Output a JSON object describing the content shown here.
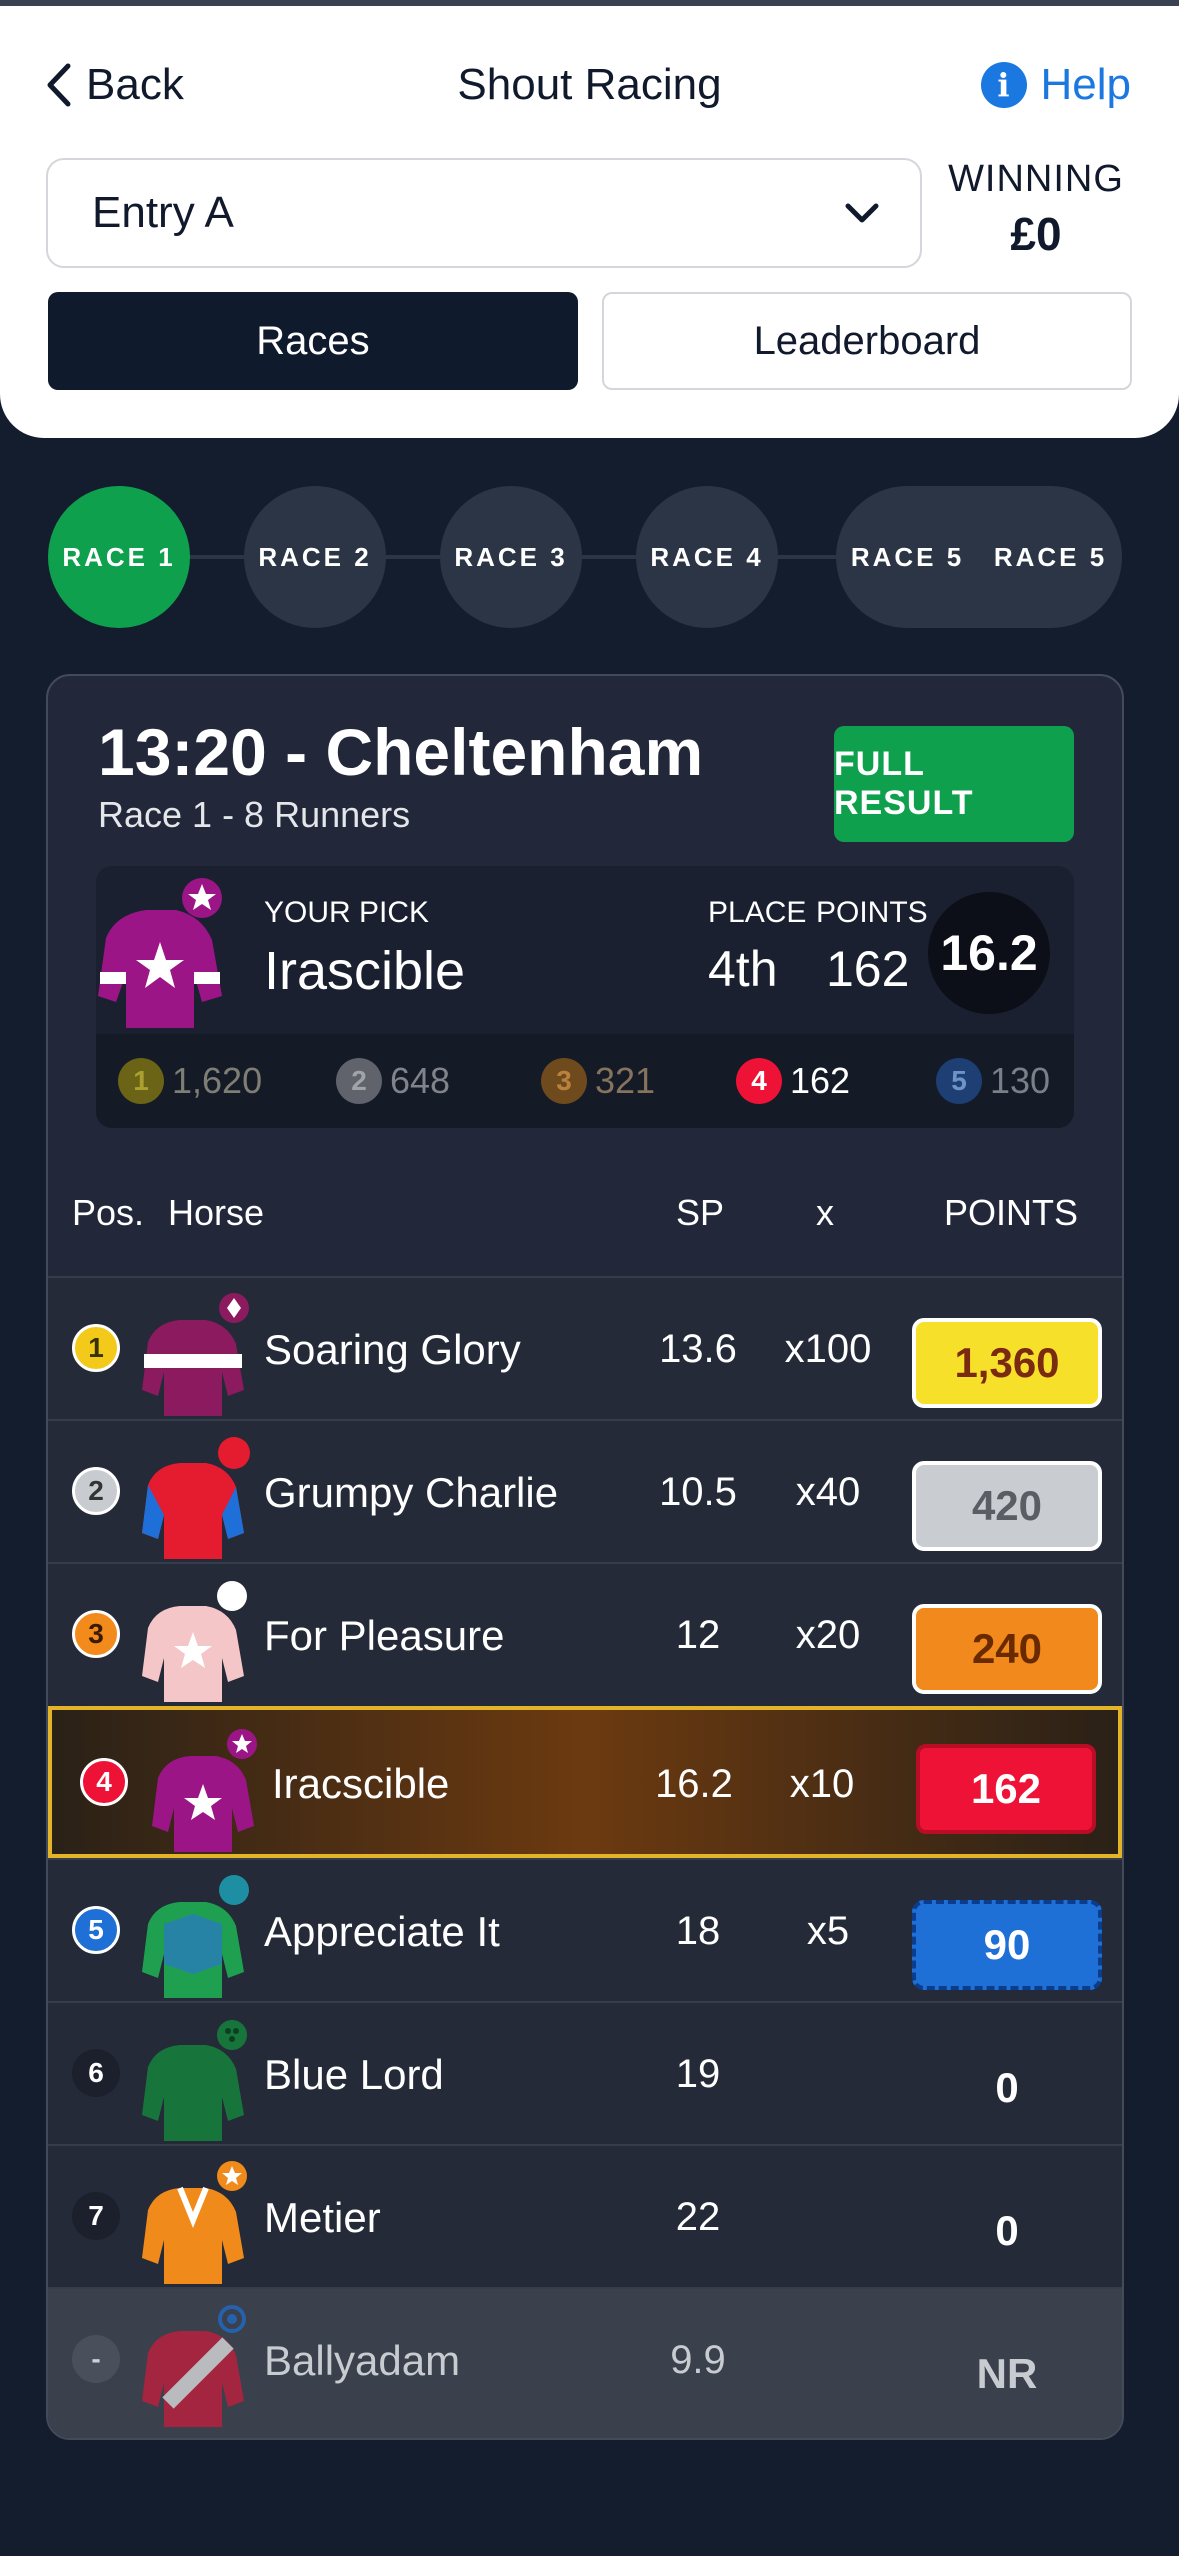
{
  "header": {
    "back_label": "Back",
    "title": "Shout Racing",
    "help_label": "Help",
    "entry_select": "Entry A",
    "winning_label": "WINNING",
    "winning_value": "£0",
    "tabs": [
      {
        "label": "Races"
      },
      {
        "label": "Leaderboard"
      }
    ]
  },
  "races_nav": [
    "RACE 1",
    "RACE 2",
    "RACE 3",
    "RACE 4",
    "RACE 5",
    "RACE 5"
  ],
  "race": {
    "title": "13:20 - Cheltenham",
    "subtitle": "Race 1 - 8 Runners",
    "full_result_label": "FULL RESULT",
    "pick": {
      "your_pick_label": "YOUR PICK",
      "horse": "Irascible",
      "place_label": "PLACE",
      "place": "4th",
      "points_label": "POINTS",
      "points": "162",
      "sp": "16.2"
    },
    "place_points": [
      {
        "pos": "1",
        "value": "1,620"
      },
      {
        "pos": "2",
        "value": "648"
      },
      {
        "pos": "3",
        "value": "321"
      },
      {
        "pos": "4",
        "value": "162"
      },
      {
        "pos": "5",
        "value": "130"
      }
    ],
    "table_headers": {
      "pos": "Pos.",
      "horse": "Horse",
      "sp": "SP",
      "x": "x",
      "points": "POINTS"
    },
    "runners": [
      {
        "pos": "1",
        "horse": "Soaring Glory",
        "sp": "13.6",
        "mult": "x100",
        "points": "1,360"
      },
      {
        "pos": "2",
        "horse": "Grumpy Charlie",
        "sp": "10.5",
        "mult": "x40",
        "points": "420"
      },
      {
        "pos": "3",
        "horse": "For Pleasure",
        "sp": "12",
        "mult": "x20",
        "points": "240"
      },
      {
        "pos": "4",
        "horse": "Iracscible",
        "sp": "16.2",
        "mult": "x10",
        "points": "162"
      },
      {
        "pos": "5",
        "horse": "Appreciate It",
        "sp": "18",
        "mult": "x5",
        "points": "90"
      },
      {
        "pos": "6",
        "horse": "Blue Lord",
        "sp": "19",
        "mult": "",
        "points": "0"
      },
      {
        "pos": "7",
        "horse": "Metier",
        "sp": "22",
        "mult": "",
        "points": "0"
      },
      {
        "pos": "-",
        "horse": "Ballyadam",
        "sp": "9.9",
        "mult": "",
        "points": "NR"
      }
    ]
  },
  "colors": {
    "accent_green": "#0fa04e",
    "gold": "#f7e02a",
    "silver": "#cfd2d6",
    "bronze": "#f28a1c",
    "red": "#ee1237",
    "blue": "#1e6fd6"
  }
}
